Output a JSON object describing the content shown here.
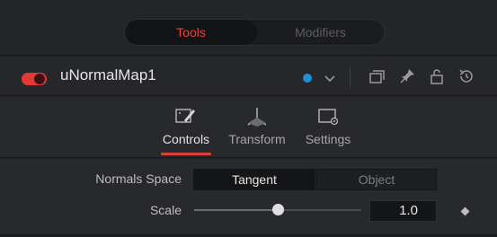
{
  "top_tabs": {
    "tools_label": "Tools",
    "modifiers_label": "Modifiers",
    "active": "Tools"
  },
  "header": {
    "tool_name": "uNormalMap1",
    "enabled": true,
    "color_dot": "#1f8fd6",
    "icons": [
      "dropdown-chevron",
      "versions-icon",
      "pin-icon",
      "lock-icon",
      "reset-icon"
    ]
  },
  "control_tabs": {
    "items": [
      {
        "label": "Controls",
        "icon": "controls-icon",
        "active": true
      },
      {
        "label": "Transform",
        "icon": "transform-icon",
        "active": false
      },
      {
        "label": "Settings",
        "icon": "settings-icon",
        "active": false
      }
    ]
  },
  "controls": {
    "normals_space": {
      "label": "Normals Space",
      "options": [
        "Tangent",
        "Object"
      ],
      "selected": "Tangent"
    },
    "scale": {
      "label": "Scale",
      "value": "1.0",
      "slider_fraction": 0.5
    }
  },
  "colors": {
    "accent_red": "#e23a37",
    "background": "#28292c"
  }
}
